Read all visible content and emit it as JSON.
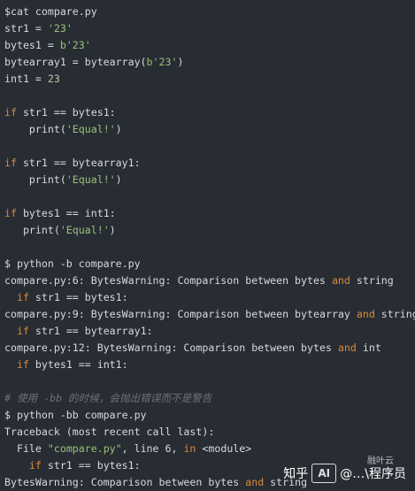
{
  "colors": {
    "background": "#282c33",
    "text": "#d7dae0",
    "keyword": "#d98b3c",
    "string": "#98c379",
    "comment": "#6b717d"
  },
  "terminal": {
    "lines": [
      [
        {
          "t": "$cat compare.py"
        }
      ],
      [
        {
          "t": "str1 = "
        },
        {
          "t": "'23'",
          "c": "str"
        }
      ],
      [
        {
          "t": "bytes1 = "
        },
        {
          "t": "b'23'",
          "c": "str"
        }
      ],
      [
        {
          "t": "bytearray1 = bytearray("
        },
        {
          "t": "b'23'",
          "c": "str"
        },
        {
          "t": ")"
        }
      ],
      [
        {
          "t": "int1 = "
        },
        {
          "t": "23",
          "c": "num"
        }
      ],
      [],
      [
        {
          "t": "if",
          "c": "kw"
        },
        {
          "t": " str1 == bytes1:"
        }
      ],
      [
        {
          "t": "    print("
        },
        {
          "t": "'Equal!'",
          "c": "str"
        },
        {
          "t": ")"
        }
      ],
      [],
      [
        {
          "t": "if",
          "c": "kw"
        },
        {
          "t": " str1 == bytearray1:"
        }
      ],
      [
        {
          "t": "    print("
        },
        {
          "t": "'Equal!'",
          "c": "str"
        },
        {
          "t": ")"
        }
      ],
      [],
      [
        {
          "t": "if",
          "c": "kw"
        },
        {
          "t": " bytes1 == int1:"
        }
      ],
      [
        {
          "t": "   print("
        },
        {
          "t": "'Equal!'",
          "c": "str"
        },
        {
          "t": ")"
        }
      ],
      [],
      [
        {
          "t": "$ python -b compare.py"
        }
      ],
      [
        {
          "t": "compare.py:6: BytesWarning: Comparison between bytes "
        },
        {
          "t": "and",
          "c": "kw"
        },
        {
          "t": " string"
        }
      ],
      [
        {
          "t": "  "
        },
        {
          "t": "if",
          "c": "kw"
        },
        {
          "t": " str1 == bytes1:"
        }
      ],
      [
        {
          "t": "compare.py:9: BytesWarning: Comparison between bytearray "
        },
        {
          "t": "and",
          "c": "kw"
        },
        {
          "t": " string"
        }
      ],
      [
        {
          "t": "  "
        },
        {
          "t": "if",
          "c": "kw"
        },
        {
          "t": " str1 == bytearray1:"
        }
      ],
      [
        {
          "t": "compare.py:12: BytesWarning: Comparison between bytes "
        },
        {
          "t": "and",
          "c": "kw"
        },
        {
          "t": " int"
        }
      ],
      [
        {
          "t": "  "
        },
        {
          "t": "if",
          "c": "kw"
        },
        {
          "t": " bytes1 == int1:"
        }
      ],
      [],
      [
        {
          "t": "# 使用 -bb 的时候，会抛出错误而不是警告",
          "c": "cmt"
        }
      ],
      [
        {
          "t": "$ python -bb compare.py"
        }
      ],
      [
        {
          "t": "Traceback (most recent call last):"
        }
      ],
      [
        {
          "t": "  File "
        },
        {
          "t": "\"compare.py\"",
          "c": "str"
        },
        {
          "t": ", line 6, "
        },
        {
          "t": "in",
          "c": "kw"
        },
        {
          "t": " <module>"
        }
      ],
      [
        {
          "t": "    "
        },
        {
          "t": "if",
          "c": "kw"
        },
        {
          "t": " str1 == bytes1:"
        }
      ],
      [
        {
          "t": "BytesWarning: Comparison between bytes "
        },
        {
          "t": "and",
          "c": "kw"
        },
        {
          "t": " string"
        }
      ]
    ]
  },
  "watermark": {
    "site": "知乎",
    "logo": "AI",
    "author": "@…\\程序员",
    "sub": "融叶云"
  }
}
